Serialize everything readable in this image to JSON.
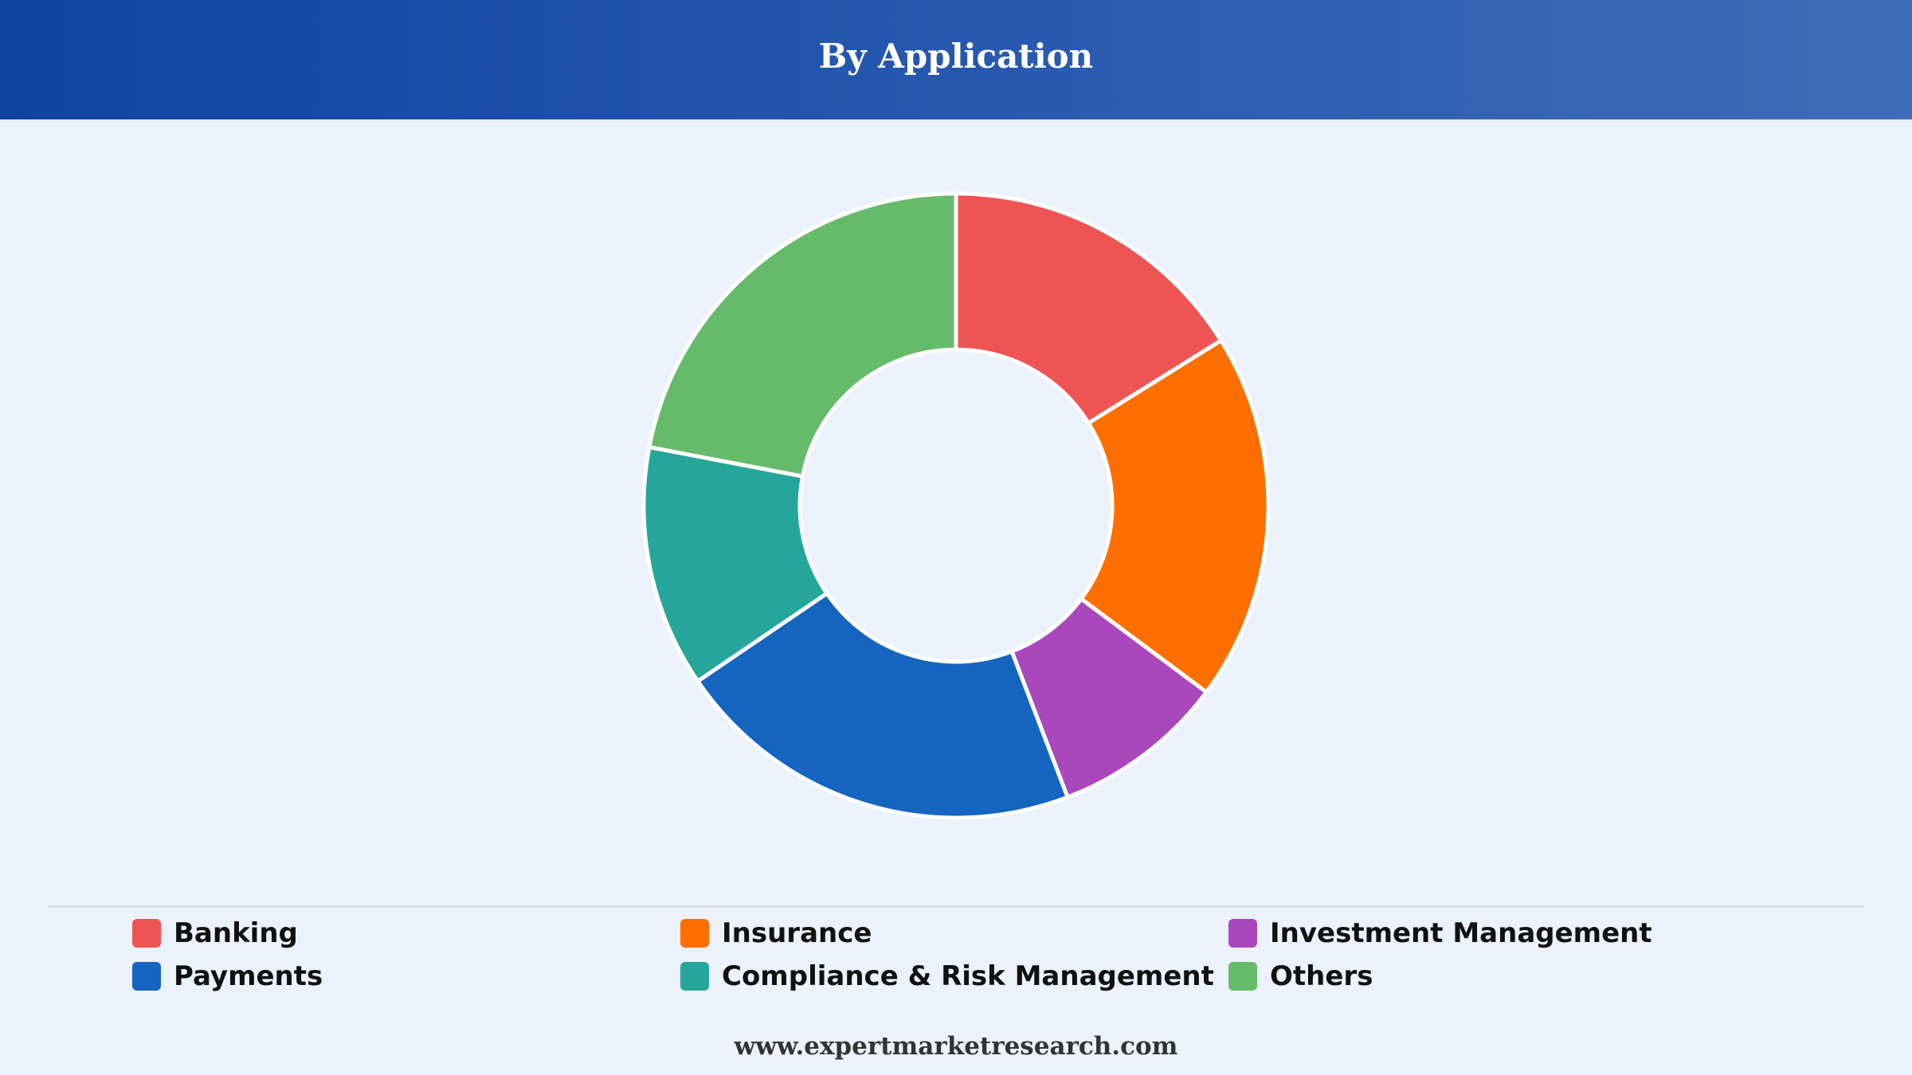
{
  "header": {
    "title": "By Application"
  },
  "chart_data": {
    "type": "pie",
    "variant": "donut",
    "title": "By Application",
    "categories": [
      "Banking",
      "Insurance",
      "Investment Management",
      "Payments",
      "Compliance & Risk Management",
      "Others"
    ],
    "values": [
      16.5,
      19.5,
      9.2,
      21.8,
      12.8,
      22.5
    ],
    "colors": [
      "#ef5454",
      "#ff6f00",
      "#ab47bc",
      "#1565c0",
      "#26a69a",
      "#66bb6a"
    ],
    "legend_position": "bottom",
    "start_angle_deg": 0,
    "direction": "clockwise"
  },
  "legend": {
    "items": [
      {
        "label": "Banking",
        "color": "#ef5454"
      },
      {
        "label": "Insurance",
        "color": "#ff6f00"
      },
      {
        "label": "Investment Management",
        "color": "#ab47bc"
      },
      {
        "label": "Payments",
        "color": "#1565c0"
      },
      {
        "label": "Compliance & Risk Management",
        "color": "#26a69a"
      },
      {
        "label": "Others",
        "color": "#66bb6a"
      }
    ]
  },
  "footer": {
    "source": "www.expertmarketresearch.com"
  }
}
